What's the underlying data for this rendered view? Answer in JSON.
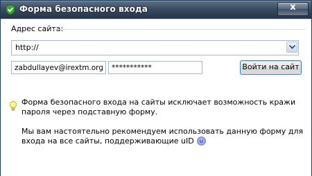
{
  "window": {
    "title": "Форма безопасного входа",
    "close_label": "x"
  },
  "form": {
    "address_label": "Адрес сайта:",
    "url_value": "http://",
    "login_value": "zabdullayev@irextm.org",
    "password_value": "***********",
    "submit_label": "Войти на сайт"
  },
  "info": {
    "line1": "Форма безопасного входа на сайты исключает возможность кражи пароля через подставную форму.",
    "line2": "Мы вам настоятельно рекомендуем использовать данную форму для входа на все сайты, поддерживающие uID",
    "badge_text": "u"
  },
  "colors": {
    "titlebar": "#3a4c62",
    "border": "#a7b7c8",
    "shield": "#3aa832"
  },
  "icons": [
    "shield-check-icon",
    "close-icon",
    "chevron-down-icon",
    "lightbulb-icon",
    "uid-badge-icon"
  ]
}
